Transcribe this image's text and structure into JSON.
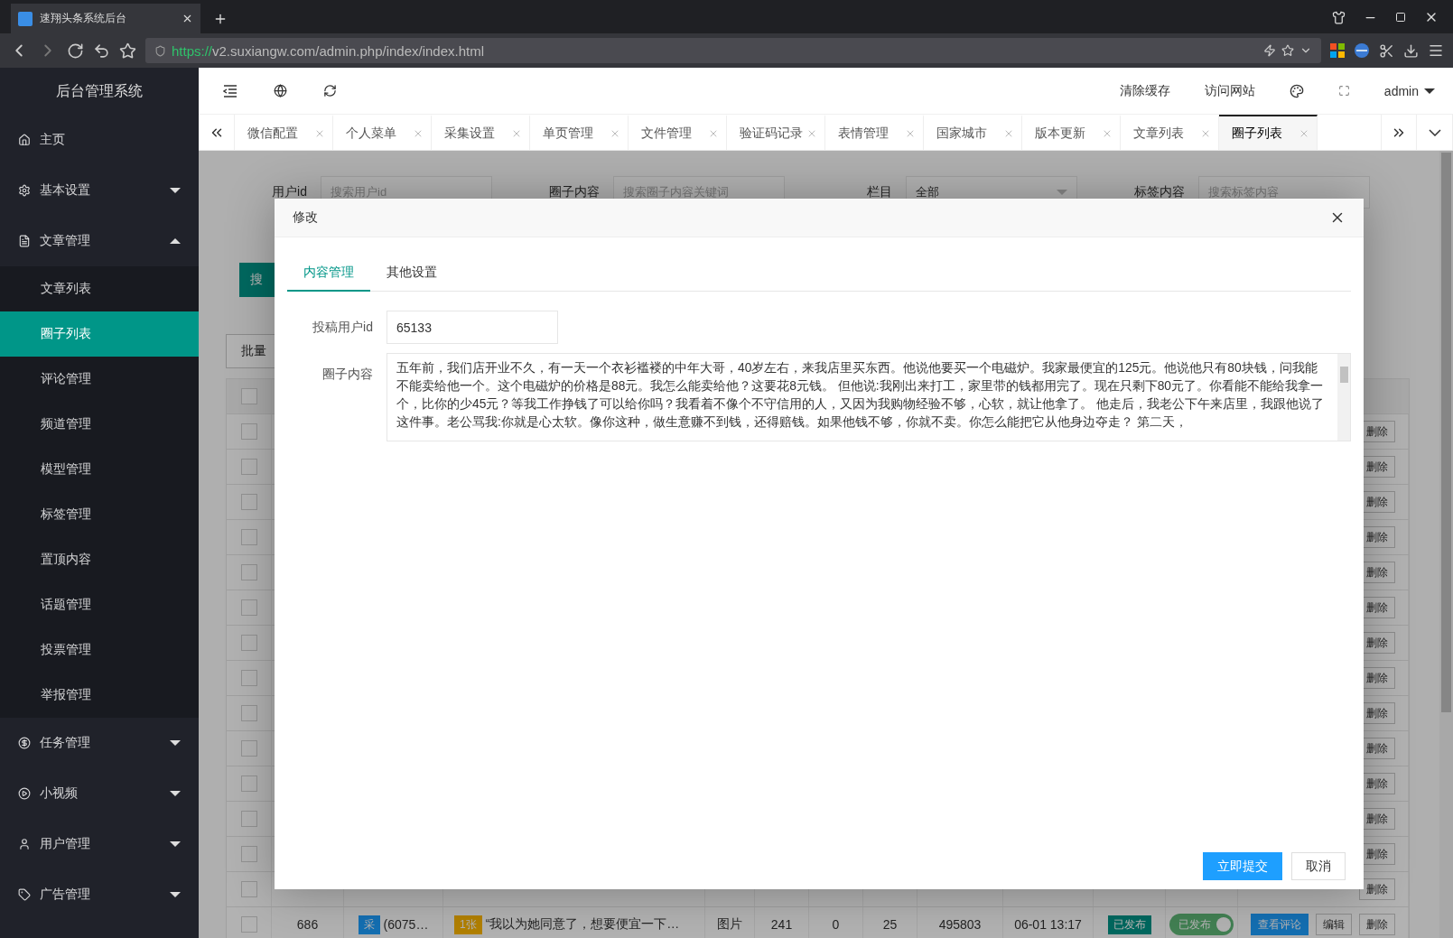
{
  "browser": {
    "tab_title": "速翔头条系统后台",
    "url_scheme": "https://",
    "url_rest": "v2.suxiangw.com/admin.php/index/index.html"
  },
  "sidebar": {
    "title": "后台管理系统",
    "items": [
      {
        "label": "主页",
        "kind": "link"
      },
      {
        "label": "基本设置",
        "kind": "group",
        "expanded": false
      },
      {
        "label": "文章管理",
        "kind": "group",
        "expanded": true,
        "children": [
          {
            "label": "文章列表",
            "selected": false
          },
          {
            "label": "圈子列表",
            "selected": true
          },
          {
            "label": "评论管理",
            "selected": false
          },
          {
            "label": "频道管理",
            "selected": false
          },
          {
            "label": "模型管理",
            "selected": false
          },
          {
            "label": "标签管理",
            "selected": false
          },
          {
            "label": "置顶内容",
            "selected": false
          },
          {
            "label": "话题管理",
            "selected": false
          },
          {
            "label": "投票管理",
            "selected": false
          },
          {
            "label": "举报管理",
            "selected": false
          }
        ]
      },
      {
        "label": "任务管理",
        "kind": "group",
        "expanded": false
      },
      {
        "label": "小视频",
        "kind": "group",
        "expanded": false
      },
      {
        "label": "用户管理",
        "kind": "group",
        "expanded": false
      },
      {
        "label": "广告管理",
        "kind": "group",
        "expanded": false
      }
    ]
  },
  "header": {
    "actions": [
      "清除缓存",
      "访问网站"
    ],
    "user": "admin"
  },
  "tabs": [
    {
      "label": "微信配置",
      "selected": false
    },
    {
      "label": "个人菜单",
      "selected": false
    },
    {
      "label": "采集设置",
      "selected": false
    },
    {
      "label": "单页管理",
      "selected": false
    },
    {
      "label": "文件管理",
      "selected": false
    },
    {
      "label": "验证码记录",
      "selected": false
    },
    {
      "label": "表情管理",
      "selected": false
    },
    {
      "label": "国家城市",
      "selected": false
    },
    {
      "label": "版本更新",
      "selected": false
    },
    {
      "label": "文章列表",
      "selected": false
    },
    {
      "label": "圈子列表",
      "selected": true
    }
  ],
  "filters": [
    {
      "kind": "input",
      "label": "用户id",
      "placeholder": "搜索用户id"
    },
    {
      "kind": "input",
      "label": "圈子内容",
      "placeholder": "搜索圈子内容关键词"
    },
    {
      "kind": "select",
      "label": "栏目",
      "value": "全部"
    },
    {
      "kind": "input",
      "label": "标签内容",
      "placeholder": "搜索标签内容"
    }
  ],
  "search_button": "搜",
  "batch_button": "批量",
  "table": {
    "all_checked": false,
    "rows": [
      {
        "checked": false,
        "delete": "删除"
      },
      {
        "checked": false,
        "delete": "删除"
      },
      {
        "checked": false,
        "delete": "删除"
      },
      {
        "checked": false,
        "delete": "删除"
      },
      {
        "checked": false,
        "delete": "删除"
      },
      {
        "checked": false,
        "delete": "删除"
      },
      {
        "checked": false,
        "delete": "删除"
      },
      {
        "checked": false,
        "delete": "删除"
      },
      {
        "checked": false,
        "delete": "删除"
      },
      {
        "checked": false,
        "delete": "删除"
      },
      {
        "checked": false,
        "delete": "删除"
      },
      {
        "checked": false,
        "delete": "删除"
      },
      {
        "checked": false,
        "delete": "删除"
      },
      {
        "checked": false,
        "delete": "删除"
      },
      {
        "checked": false,
        "id": "686",
        "source": "采",
        "user": "(6075…",
        "images": "1张",
        "content": "“我以为她同意了，想要便宜一下…",
        "type": "图片",
        "views": "241",
        "likes": "0",
        "comments": "25",
        "hot": "495803",
        "time": "06-01 13:17",
        "status": "已发布",
        "switch_label": "已发布",
        "switch_on": true,
        "view_comments": "查看评论",
        "edit": "编辑",
        "delete": "删除"
      }
    ]
  },
  "modal": {
    "title": "修改",
    "tabs": [
      {
        "label": "内容管理",
        "selected": true
      },
      {
        "label": "其他设置",
        "selected": false
      }
    ],
    "fields": [
      {
        "kind": "input",
        "label": "投稿用户id",
        "value": "65133"
      },
      {
        "kind": "textarea",
        "label": "圈子内容",
        "value": "五年前，我们店开业不久，有一天一个衣衫褴褛的中年大哥，40岁左右，来我店里买东西。他说他要买一个电磁炉。我家最便宜的125元。他说他只有80块钱，问我能不能卖给他一个。这个电磁炉的价格是88元。我怎么能卖给他？这要花8元钱。 但他说:我刚出来打工，家里带的钱都用完了。现在只剩下80元了。你看能不能给我拿一个，比你的少45元？等我工作挣钱了可以给你吗？我看着不像个不守信用的人，又因为我购物经验不够，心软，就让他拿了。 他走后，我老公下午来店里，我跟他说了这件事。老公骂我:你就是心太软。像你这种，做生意赚不到钱，还得赔钱。如果他钱不够，你就不卖。你怎么能把它从他身边夺走？ 第二天，"
      }
    ],
    "submit": "立即提交",
    "cancel": "取消"
  }
}
